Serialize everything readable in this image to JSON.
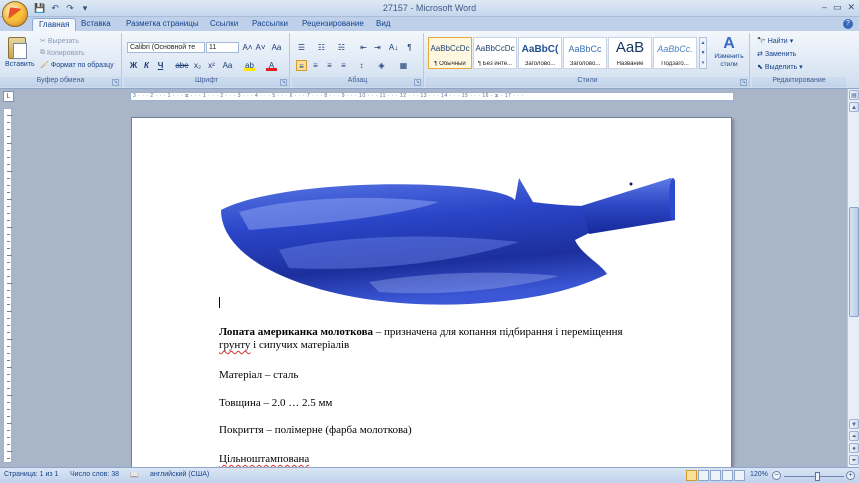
{
  "window": {
    "title": "27157 - Microsoft Word",
    "controls": [
      "–",
      "▭",
      "✕"
    ]
  },
  "qat": {
    "save": "💾",
    "undo": "↶",
    "redo": "↷",
    "customize": "▾"
  },
  "tabs": [
    "Главная",
    "Вставка",
    "Разметка страницы",
    "Ссылки",
    "Рассылки",
    "Рецензирование",
    "Вид"
  ],
  "active_tab": "Главная",
  "ribbon": {
    "clipboard": {
      "label": "Буфер обмена",
      "paste": "Вставить",
      "cut": "Вырезать",
      "copy": "Копировать",
      "format_painter": "Формат по образцу"
    },
    "font": {
      "label": "Шрифт",
      "font_name": "Calibri (Основной те",
      "font_size": "11",
      "grow": "A˄",
      "shrink": "A˅",
      "clear": "Aa",
      "bold": "Ж",
      "italic": "К",
      "underline": "Ч",
      "strike": "abe",
      "sub": "x₂",
      "sup": "x²",
      "case": "Aa",
      "highlight": "ab",
      "font_color": "A"
    },
    "paragraph": {
      "label": "Абзац",
      "bullets": "☰",
      "numbering": "☷",
      "multilevel": "☵",
      "decrease": "⇤",
      "increase": "⇥",
      "sort": "A↓",
      "pilcrow": "¶",
      "align_left": "≡",
      "center": "≡",
      "align_right": "≡",
      "justify": "≡",
      "spacing": "↕",
      "shading": "◈",
      "borders": "▦"
    },
    "styles": {
      "label": "Стили",
      "items": [
        {
          "sample": "AaBbCcDc",
          "name": "¶ Обычный"
        },
        {
          "sample": "AaBbCcDc",
          "name": "¶ Без инте..."
        },
        {
          "sample": "AaBbC(",
          "name": "Заголово..."
        },
        {
          "sample": "AaBbCc",
          "name": "Заголово..."
        },
        {
          "sample": "AaB",
          "name": "Название"
        },
        {
          "sample": "AaBbCc.",
          "name": "Подзаго..."
        }
      ],
      "change_styles": "Изменить стили"
    },
    "editing": {
      "label": "Редактирование",
      "find": "Найти",
      "replace": "Заменить",
      "select": "Выделить"
    }
  },
  "ruler": {
    "ticks": "3 · · · 2 · · · 1 · · · ⧖ · · · 1 · · · 2 · · · 3 · · · 4 · · · 5 · · · 6 · · · 7 · · · 8 · · · 9 · · · 10 · · · 11 · · · 12 · · · 13 · · · 14 · · · 15 · · · 16 · ⧖ · 17 · · ·",
    "corner": "L"
  },
  "document": {
    "title_bold": "Лопата американка молоткова",
    "title_rest": " – призначена для копання підбирання і переміщення",
    "title_line2_a": "грунту",
    "title_line2_b": " і сипучих матеріалів",
    "material": "Матеріал  – сталь",
    "thickness": "Товщина – 2.0  … 2.5  мм",
    "coating": "Покриття – полімерне  (фарба молоткова)",
    "stamped": "Цільноштампована",
    "shovel_color": "#2a45c8"
  },
  "status": {
    "page": "Страница: 1 из 1",
    "words": "Число слов: 38",
    "language": "английский (США)",
    "zoom": "120%"
  }
}
